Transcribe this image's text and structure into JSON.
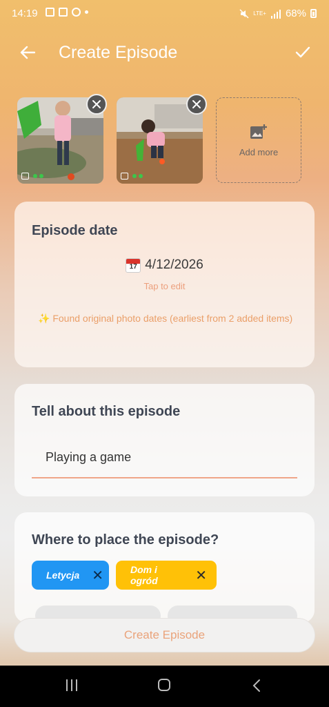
{
  "status": {
    "time": "14:19",
    "battery": "68%",
    "network": "LTE+"
  },
  "appbar": {
    "title": "Create Episode",
    "back_icon": "arrow-left-icon",
    "confirm_icon": "check-icon"
  },
  "media": {
    "items": [
      {
        "type": "image",
        "close_icon": "close-icon"
      },
      {
        "type": "image",
        "close_icon": "close-icon"
      }
    ],
    "add_more_label": "Add more",
    "add_more_icon": "add-photo-icon"
  },
  "date_card": {
    "title": "Episode date",
    "calendar_icon_day": "17",
    "date": "4/12/2026",
    "tap_hint": "Tap to edit",
    "found_note": "✨ Found original photo dates (earliest from 2 added items)"
  },
  "tell_card": {
    "title": "Tell about this episode",
    "value": "Playing a game"
  },
  "place_card": {
    "title": "Where to place the episode?",
    "chips": [
      {
        "label": "Letycja",
        "color": "#2196f3"
      },
      {
        "label": "Dom i ogród",
        "color": "#ffc107"
      }
    ]
  },
  "create_button": "Create Episode",
  "colors": {
    "accent": "#efa588",
    "chip_blue": "#2196f3",
    "chip_yellow": "#ffc107"
  }
}
